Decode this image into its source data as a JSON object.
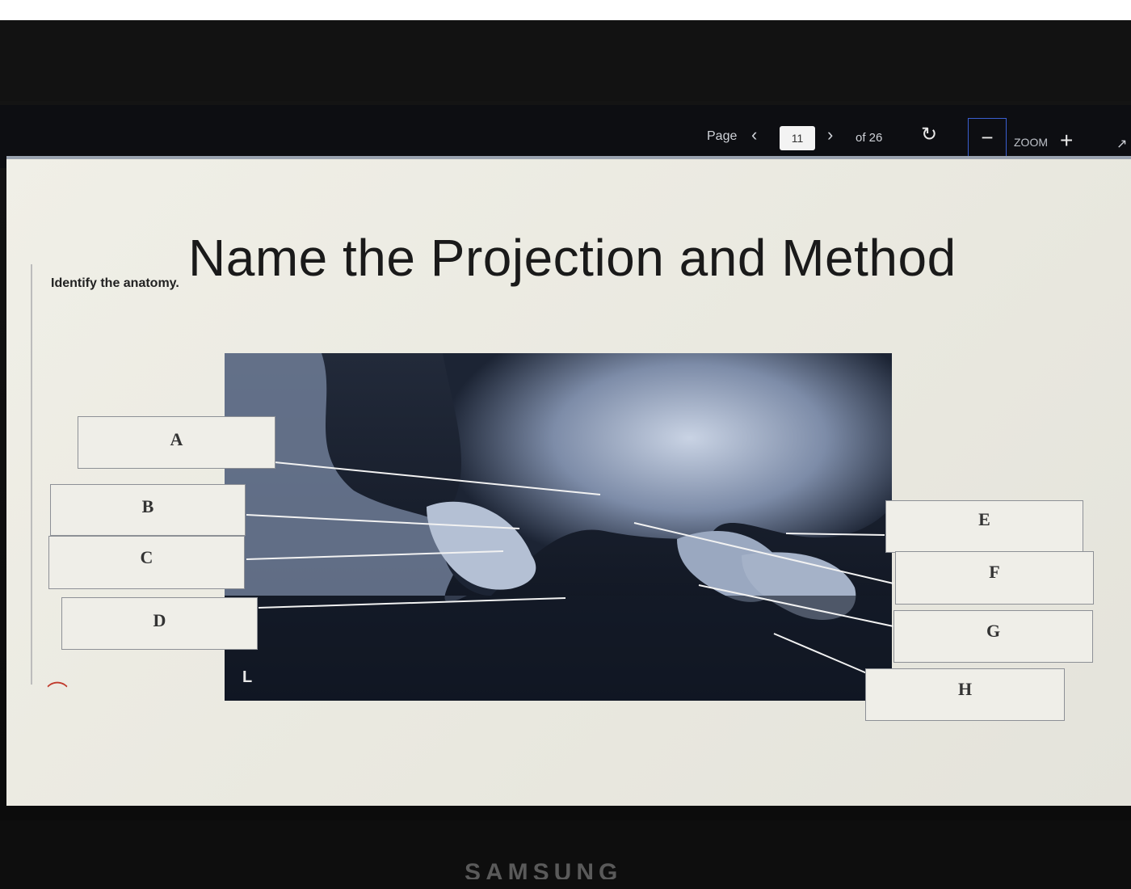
{
  "toolbar": {
    "page_label": "Page",
    "prev_icon": "‹",
    "page_value": "11",
    "next_icon": "›",
    "page_total": "of 26",
    "rotate_icon": "↻",
    "zoom_out_icon": "−",
    "zoom_label": "ZOOM",
    "zoom_in_icon": "+",
    "expand_icon": "↗"
  },
  "slide": {
    "instruction": "Identify the anatomy.",
    "title": "Name the Projection and Method",
    "image_marker": "L",
    "labels": {
      "a": "A",
      "b": "B",
      "c": "C",
      "d": "D",
      "e": "E",
      "f": "F",
      "g": "G",
      "h": "H"
    }
  },
  "monitor": {
    "brand": "SAMSUNG"
  }
}
